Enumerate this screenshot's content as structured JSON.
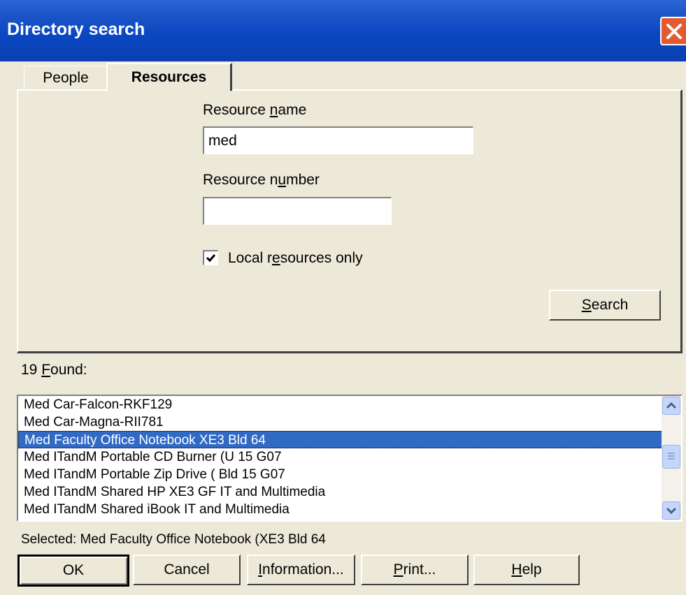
{
  "window": {
    "title": "Directory search"
  },
  "tabs": [
    {
      "label": "People",
      "active": false
    },
    {
      "label": "Resources",
      "active": true
    }
  ],
  "form": {
    "resource_name_label_pre": "Resource ",
    "resource_name_label_u": "n",
    "resource_name_label_post": "ame",
    "resource_name_value": "med",
    "resource_number_label_pre": "Resource n",
    "resource_number_label_u": "u",
    "resource_number_label_post": "mber",
    "resource_number_value": "",
    "local_only_label_pre": "Local r",
    "local_only_label_u": "e",
    "local_only_label_post": "sources only",
    "local_only_checked": true,
    "search_button_u": "S",
    "search_button_post": "earch"
  },
  "results": {
    "count_pre": "19 ",
    "count_u": "F",
    "count_post": "ound:",
    "items": [
      "Med Car-Falcon-RKF129",
      "Med Car-Magna-RII781",
      "Med Faculty Office Notebook XE3  Bld 64",
      "Med ITandM Portable CD Burner (U  15 G07",
      "Med ITandM Portable Zip Drive (   Bld 15 G07",
      "Med ITandM Shared HP XE3 GF  IT and Multimedia",
      "Med ITandM Shared iBook  IT and Multimedia"
    ],
    "selected_index": 2,
    "selected_text": "Selected: Med Faculty Office Notebook (XE3  Bld 64"
  },
  "buttons": {
    "ok": "OK",
    "cancel": "Cancel",
    "information_u": "I",
    "information_post": "nformation...",
    "print_u": "P",
    "print_post": "rint...",
    "help_u": "H",
    "help_post": "elp"
  },
  "colors": {
    "titlebar": "#0a47c2",
    "selection": "#316ac5",
    "close": "#e35a32"
  }
}
